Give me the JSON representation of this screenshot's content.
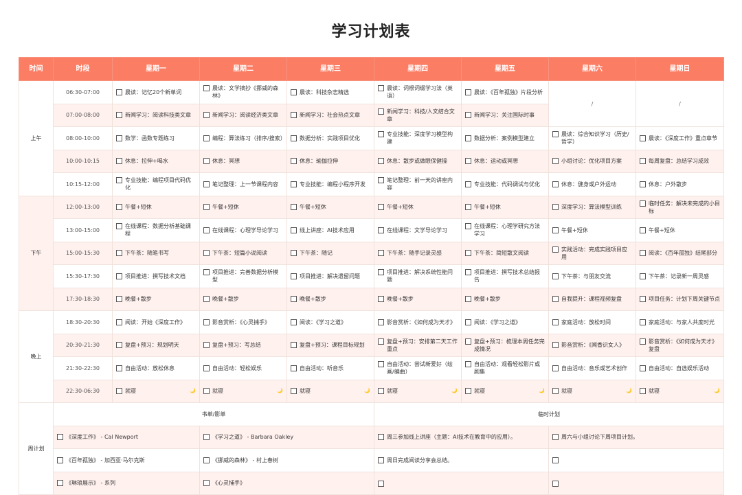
{
  "title": "学习计划表",
  "headers": [
    "时间",
    "时段",
    "星期一",
    "星期二",
    "星期三",
    "星期四",
    "星期五",
    "星期六",
    "星期日"
  ],
  "periods": [
    "上午",
    "下午",
    "晚上",
    "周计划"
  ],
  "na_mark": "/",
  "sleep_emoji": "🌙",
  "rows": [
    {
      "slot": "06:30-07:00",
      "mon": "晨读：记忆20个新单词",
      "tue": "晨读：文学摘抄《挪威的森林》",
      "wed": "晨读：科技杂志精选",
      "thu": "晨读：词根词缀学习法（英语）",
      "fri": "晨读：《百年孤独》片段分析"
    },
    {
      "slot": "07:00-08:00",
      "mon": "新闻学习：阅读科技类文章",
      "tue": "新闻学习：阅读经济类文章",
      "wed": "新闻学习：社会热点文章",
      "thu": "新闻学习：科技/人文结合文章",
      "fri": "新闻学习：关注国际时事"
    },
    {
      "slot": "08:00-10:00",
      "mon": "数学：函数专题练习",
      "tue": "编程：算法练习（排序/搜索）",
      "wed": "数据分析：实践项目优化",
      "thu": "专业技能：深度学习模型构建",
      "fri": "数据分析：案例模型建立",
      "sat": "晨读：综合知识学习（历史/哲学）",
      "sun": "晨读：《深度工作》重点章节"
    },
    {
      "slot": "10:00-10:15",
      "mon": "休息：拉伸+喝水",
      "tue": "休息：冥想",
      "wed": "休息：瑜伽拉伸",
      "thu": "休息：散步或做眼保健操",
      "fri": "休息：运动或冥想",
      "sat": "小组讨论：优化项目方案",
      "sun": "每周复盘：总结学习成效"
    },
    {
      "slot": "10:15-12:00",
      "mon": "专业技能：编程项目代码优化",
      "tue": "笔记整理：上一节课程内容",
      "wed": "专业技能：编程小程序开发",
      "thu": "笔记整理：前一天的讲座内容",
      "fri": "专业技能：代码调试与优化",
      "sat": "休息：健身或户外运动",
      "sun": "休息：户外散步"
    },
    {
      "slot": "12:00-13:00",
      "mon": "午餐+短休",
      "tue": "午餐+短休",
      "wed": "午餐+短休",
      "thu": "午餐+短休",
      "fri": "午餐+短休",
      "sat": "深度学习：算法模型训练",
      "sun": "临时任务：解决未完成的小目标"
    },
    {
      "slot": "13:00-15:00",
      "mon": "在线课程：数据分析基础课程",
      "tue": "在线课程：心理学导论学习",
      "wed": "线上讲座：AI技术应用",
      "thu": "在线课程：文学导论学习",
      "fri": "在线课程：心理学研究方法学习",
      "sat": "午餐+短休",
      "sun": "午餐+短休"
    },
    {
      "slot": "15:00-15:30",
      "mon": "下午茶：随笔书写",
      "tue": "下午茶：短篇小说阅读",
      "wed": "下午茶：随记",
      "thu": "下午茶：随手记录灵感",
      "fri": "下午茶：简短散文阅读",
      "sat": "实践活动：完成实践项目应用",
      "sun": "阅读：《百年孤独》结尾部分"
    },
    {
      "slot": "15:30-17:30",
      "mon": "项目推进：撰写技术文档",
      "tue": "项目推进：完善数据分析模型",
      "wed": "项目推进：解决遗留问题",
      "thu": "项目推进：解决系统性能问题",
      "fri": "项目推进：撰写技术总结报告",
      "sat": "下午茶：与朋友交流",
      "sun": "下午茶：记录新一周灵感"
    },
    {
      "slot": "17:30-18:30",
      "mon": "晚餐+散步",
      "tue": "晚餐+散步",
      "wed": "晚餐+散步",
      "thu": "晚餐+散步",
      "fri": "晚餐+散步",
      "sat": "自我提升：课程视频复盘",
      "sun": "项目任务：计划下周关键节点"
    },
    {
      "slot": "18:30-20:30",
      "mon": "阅读：开始《深度工作》",
      "tue": "影音赏析：《心灵捕手》",
      "wed": "阅读：《学习之道》",
      "thu": "影音赏析：《如何成为天才》",
      "fri": "阅读：《学习之道》",
      "sat": "家庭活动：放松时间",
      "sun": "家庭活动：与家人共度时光"
    },
    {
      "slot": "20:30-21:30",
      "mon": "复盘+预习：规划明天",
      "tue": "复盘+预习：写总结",
      "wed": "复盘+预习：课程目标规划",
      "thu": "复盘+预习：安排第二天工作重点",
      "fri": "复盘+预习：梳理本周任务完成情况",
      "sat": "影音赏析：《闻香识女人》",
      "sun": "影音赏析：《如何成为天才》复盘"
    },
    {
      "slot": "21:30-22:30",
      "mon": "自由活动：放松休息",
      "tue": "自由活动：轻松娱乐",
      "wed": "自由活动：听音乐",
      "thu": "自由活动：尝试新爱好（绘画/编曲）",
      "fri": "自由活动：观看轻松影片或剧集",
      "sat": "自由活动：音乐或艺术创作",
      "sun": "自由活动：自选娱乐活动"
    },
    {
      "slot": "22:30-06:30",
      "mon": "就寝",
      "tue": "就寝",
      "wed": "就寝",
      "thu": "就寝",
      "fri": "就寝",
      "sat": "就寝",
      "sun": "就寝"
    }
  ],
  "weekly": {
    "books_header": "书单/影单",
    "temp_header": "临时计划",
    "books": [
      [
        "《深度工作》 - Cal Newport",
        "《学习之道》 - Barbara Oakley"
      ],
      [
        "《百年孤独》 - 加西亚·马尔克斯",
        "《挪威的森林》 - 村上春树"
      ],
      [
        "《琳琅展示》 - 系列",
        "《心灵捕手》"
      ]
    ],
    "temp": [
      [
        "周三参加线上讲座（主题：AI技术在教育中的应用）。",
        "周六与小组讨论下周项目计划。"
      ],
      [
        "周日完成阅读分享会总结。",
        ""
      ],
      [
        "",
        ""
      ]
    ]
  }
}
